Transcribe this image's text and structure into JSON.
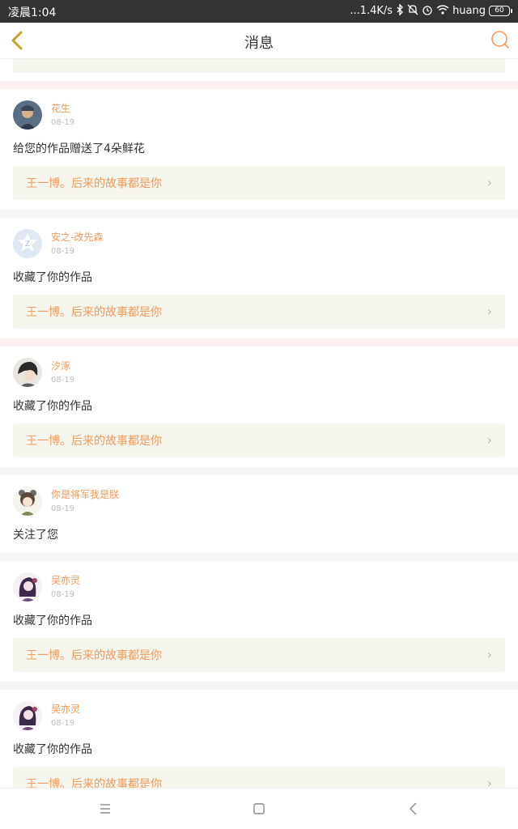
{
  "status_bar": {
    "time": "凌晨1:04",
    "network_speed": "...1.4K/s",
    "icons": [
      "bluetooth-icon",
      "mute-icon",
      "alarm-icon",
      "wifi-icon"
    ],
    "carrier": "huang",
    "battery": "60"
  },
  "nav": {
    "title": "消息",
    "back_icon": "chevron-left-icon",
    "chat_icon": "chat-bubble-icon",
    "accent_color": "#f29a5b"
  },
  "notifications": [
    {
      "user": "花生",
      "date": "08-19",
      "action": "给您的作品赠送了4朵鲜花",
      "work_title": "王一博。后来的故事都是你"
    },
    {
      "user": "安之-改先森",
      "date": "08-19",
      "action": "收藏了你的作品",
      "work_title": "王一博。后来的故事都是你"
    },
    {
      "user": "汐涿",
      "date": "08-19",
      "action": "收藏了你的作品",
      "work_title": "王一博。后来的故事都是你"
    },
    {
      "user": "你是将军我是朕",
      "date": "08-19",
      "action": "关注了您"
    },
    {
      "user": "吴亦灵",
      "date": "08-19",
      "action": "收藏了你的作品",
      "work_title": "王一博。后来的故事都是你"
    },
    {
      "user": "吴亦灵",
      "date": "08-19",
      "action": "收藏了你的作品",
      "work_title": "王一博。后来的故事都是你"
    }
  ],
  "system_nav": {
    "menu_icon": "menu-icon",
    "home_icon": "home-icon",
    "back_icon": "back-icon"
  }
}
